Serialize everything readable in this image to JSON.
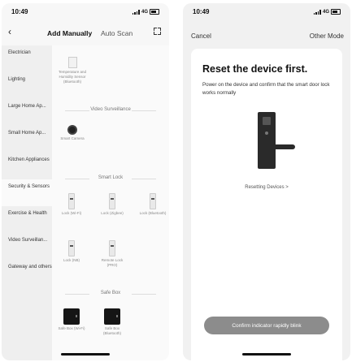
{
  "left": {
    "status": {
      "time": "10:49",
      "network": "4G"
    },
    "nav": {
      "tab_active": "Add Manually",
      "tab": "Auto Scan"
    },
    "sidebar": [
      {
        "label": "Electrician"
      },
      {
        "label": "Lighting"
      },
      {
        "label": "Large Home Ap..."
      },
      {
        "label": "Small Home Ap..."
      },
      {
        "label": "Kitchen Appliances"
      },
      {
        "label": "Security & Sensors"
      },
      {
        "label": "Exercise & Health"
      },
      {
        "label": "Video Surveillan..."
      },
      {
        "label": "Gateway and others"
      }
    ],
    "sections": {
      "video_header": "Video Surveillance",
      "lock_header": "Smart Lock",
      "safe_header": "Safe Box"
    },
    "devices": {
      "sensor": "Temperature and Humidity Sensor (Bluetooth)",
      "camera": "Smart Camera",
      "lock1": "Lock (Wi-Fi)",
      "lock2": "Lock (Zigbee)",
      "lock3": "Lock (Bluetooth)",
      "lock4": "Lock (NB)",
      "lock5": "Remote Lock (PRO)",
      "safe1": "Safe Box (Wi-Fi)",
      "safe2": "Safe Box (Bluetooth)"
    }
  },
  "right": {
    "status": {
      "time": "10:49",
      "network": "4G"
    },
    "nav": {
      "cancel": "Cancel",
      "mode": "Other Mode"
    },
    "title": "Reset the device first.",
    "description": "Power on the device and confirm that the smart door lock works normally",
    "reset_link": "Resetting Devices >",
    "confirm_button": "Confirm indicator rapidly blink"
  }
}
